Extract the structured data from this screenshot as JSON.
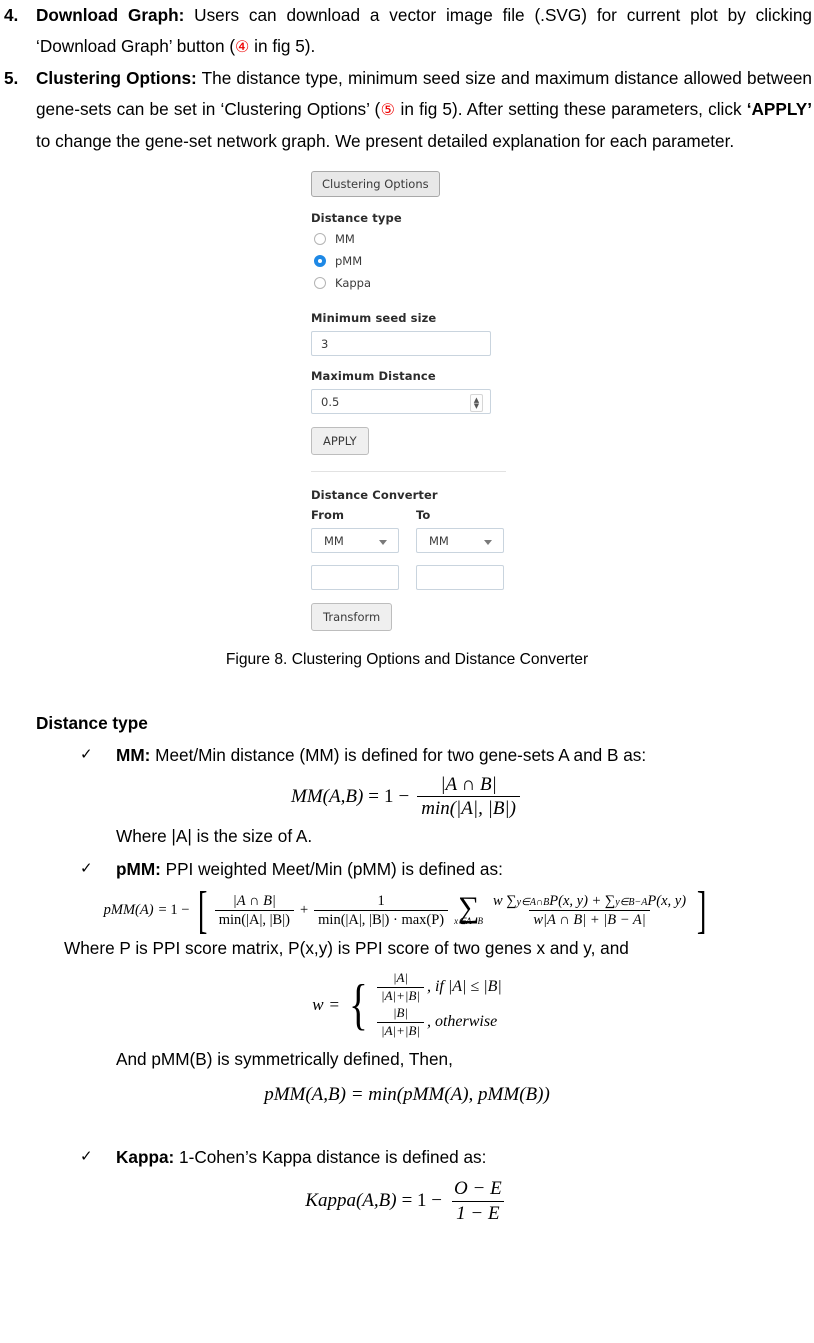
{
  "list": [
    {
      "number": "4.",
      "bold_lead": "Download Graph:",
      "text_a": " Users can download a vector image file (.SVG) for current plot by clicking ‘Download Graph’ button (",
      "circled": "④",
      "text_b": " in fig 5)."
    },
    {
      "number": "5.",
      "bold_lead": "Clustering Options:",
      "text_a": " The distance type, minimum seed size and maximum distance allowed between gene-sets can be set in ‘Clustering Options’ (",
      "circled": "⑤",
      "text_b": " in fig 5). After setting these parameters, click ",
      "bold_mid": "‘APPLY’",
      "text_c": " to change the gene-set network graph. We present detailed explanation for each parameter."
    }
  ],
  "figure": {
    "panel": {
      "header_button": "Clustering Options",
      "distance_type_label": "Distance type",
      "radios": [
        {
          "label": "MM",
          "checked": false
        },
        {
          "label": "pMM",
          "checked": true
        },
        {
          "label": "Kappa",
          "checked": false
        }
      ],
      "min_seed_label": "Minimum seed size",
      "min_seed_value": "3",
      "max_distance_label": "Maximum Distance",
      "max_distance_value": "0.5",
      "apply_button": "APPLY",
      "converter_label": "Distance Converter",
      "from_label": "From",
      "to_label": "To",
      "from_select_value": "MM",
      "to_select_value": "MM",
      "from_input_value": "",
      "to_input_value": "",
      "transform_button": "Transform",
      "accent_color": "#1e88e5"
    },
    "caption": "Figure 8. Clustering Options and Distance Converter"
  },
  "section": {
    "heading": "Distance type",
    "mm": {
      "bullet_bold": "MM:",
      "bullet_text": " Meet/Min distance (MM) is defined for two gene-sets A and B as:",
      "note": "Where |A| is the size of A.",
      "equation": {
        "lhs": "MM(A,B)",
        "eq": "=",
        "one": "1",
        "minus": "−",
        "numerator": "|A ∩ B|",
        "denominator": "min(|A|, |B|)"
      }
    },
    "pmm": {
      "bullet_bold": "pMM:",
      "bullet_text": " PPI weighted Meet/Min (pMM) is defined as:",
      "note": "Where P is PPI score matrix, P(x,y) is PPI score of two genes x and y, and",
      "equation": {
        "lhs": "pMM(A)",
        "eq": "= 1 −",
        "term1_num": "|A ∩ B|",
        "term1_den": "min(|A|, |B|)",
        "plus": "+",
        "term2_num": "1",
        "term2_den": "min(|A|, |B|) · max(P)",
        "sum_symbol": "∑",
        "sum_subscript": "x∈A−B",
        "term3_num_a": "w ∑",
        "term3_num_a_sub": "y∈A∩B",
        "term3_num_b": "P(x, y) + ∑",
        "term3_num_b_sub": "y∈B−A",
        "term3_num_c": "P(x, y)",
        "term3_den": "w|A ∩ B| + |B − A|"
      },
      "w_equation": {
        "lhs": "w",
        "eq": "=",
        "case1_num": "|A|",
        "case1_den": "|A|+|B|",
        "case1_cond": ", if |A| ≤ |B|",
        "case2_num": "|B|",
        "case2_den": "|A|+|B|",
        "case2_cond": ", otherwise"
      },
      "symmetry_note": "And pMM(B) is symmetrically defined, Then,",
      "final_equation": "pMM(A,B) = min(pMM(A), pMM(B))"
    },
    "kappa": {
      "bullet_bold": "Kappa:",
      "bullet_text": " 1-Cohen’s Kappa distance is defined as:",
      "equation": {
        "lhs": "Kappa(A,B)",
        "eq": "= 1 −",
        "numerator": "O − E",
        "denominator": "1 − E"
      }
    }
  }
}
